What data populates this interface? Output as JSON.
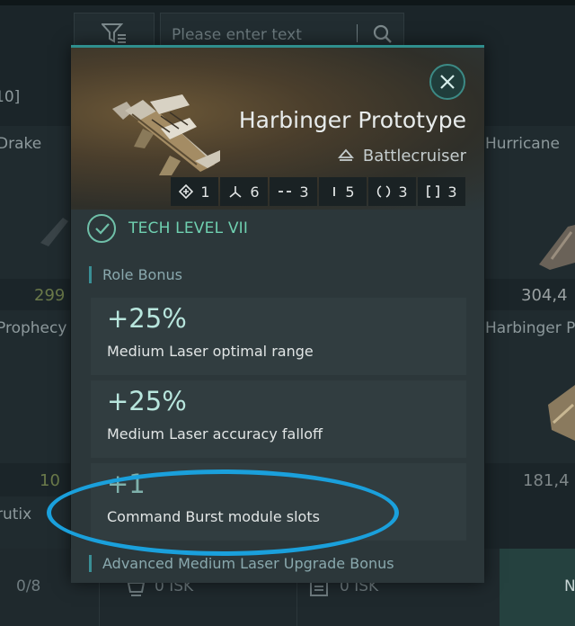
{
  "background": {
    "search": {
      "placeholder": "Please enter text"
    },
    "left_column": {
      "range_fragment": "10]",
      "items": [
        "Drake",
        "Prophecy",
        "rutix"
      ],
      "prices": [
        "299",
        "10"
      ]
    },
    "right_column": {
      "items": [
        "Hurricane",
        "Harbinger Pr"
      ],
      "prices": [
        "304,4",
        "181,4"
      ]
    },
    "bottom_bar": {
      "count": "0/8",
      "cost_1": "0 ISK",
      "cost_2": "0 ISK",
      "accent_label": "N"
    }
  },
  "popup": {
    "ship_name": "Harbinger Prototype",
    "ship_class": "Battlecruiser",
    "slots": [
      {
        "icon": "drone-icon",
        "value": "1"
      },
      {
        "icon": "turret-icon",
        "value": "6"
      },
      {
        "icon": "dash-icon",
        "value": "3"
      },
      {
        "icon": "bar-icon",
        "value": "5"
      },
      {
        "icon": "circle-slot-icon",
        "value": "3"
      },
      {
        "icon": "bracket-slot-icon",
        "value": "3"
      }
    ],
    "tech_level": "TECH LEVEL VII",
    "role_bonus_title": "Role Bonus",
    "bonuses": [
      {
        "value": "+25%",
        "description": "Medium Laser optimal range"
      },
      {
        "value": "+25%",
        "description": "Medium Laser accuracy falloff"
      },
      {
        "value": "+1",
        "description": "Command Burst module slots"
      }
    ],
    "upgrade_bonus_title": "Advanced Medium Laser Upgrade Bonus"
  },
  "colors": {
    "accent": "#2f8e8d",
    "tech_green": "#6fd0b0",
    "highlight_ring": "#1aa0dc"
  }
}
